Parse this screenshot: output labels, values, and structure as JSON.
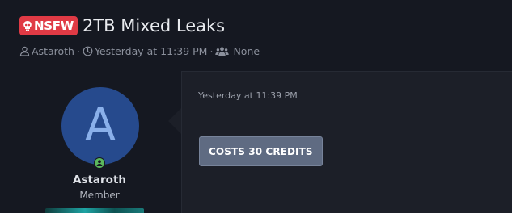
{
  "thread": {
    "prefix": "NSFW",
    "title": "2TB Mixed Leaks"
  },
  "meta": {
    "author": "Astaroth",
    "separator": "·",
    "date": "Yesterday at 11:39 PM",
    "audience": "None",
    "icons": [
      "user-icon",
      "clock-icon",
      "users-icon"
    ]
  },
  "post": {
    "avatar_letter": "A",
    "username": "Astaroth",
    "user_title": "Member",
    "date": "Yesterday at 11:39 PM",
    "unlock_button": "COSTS 30 CREDITS",
    "online_status": "online"
  },
  "colors": {
    "background": "#151821",
    "post_body": "#1c1f28",
    "prefix_badge": "#e03a45",
    "avatar_bg": "#264a8d",
    "avatar_letter": "#8ab0ea",
    "online": "#5cb85c",
    "button": "#5f6b82"
  }
}
